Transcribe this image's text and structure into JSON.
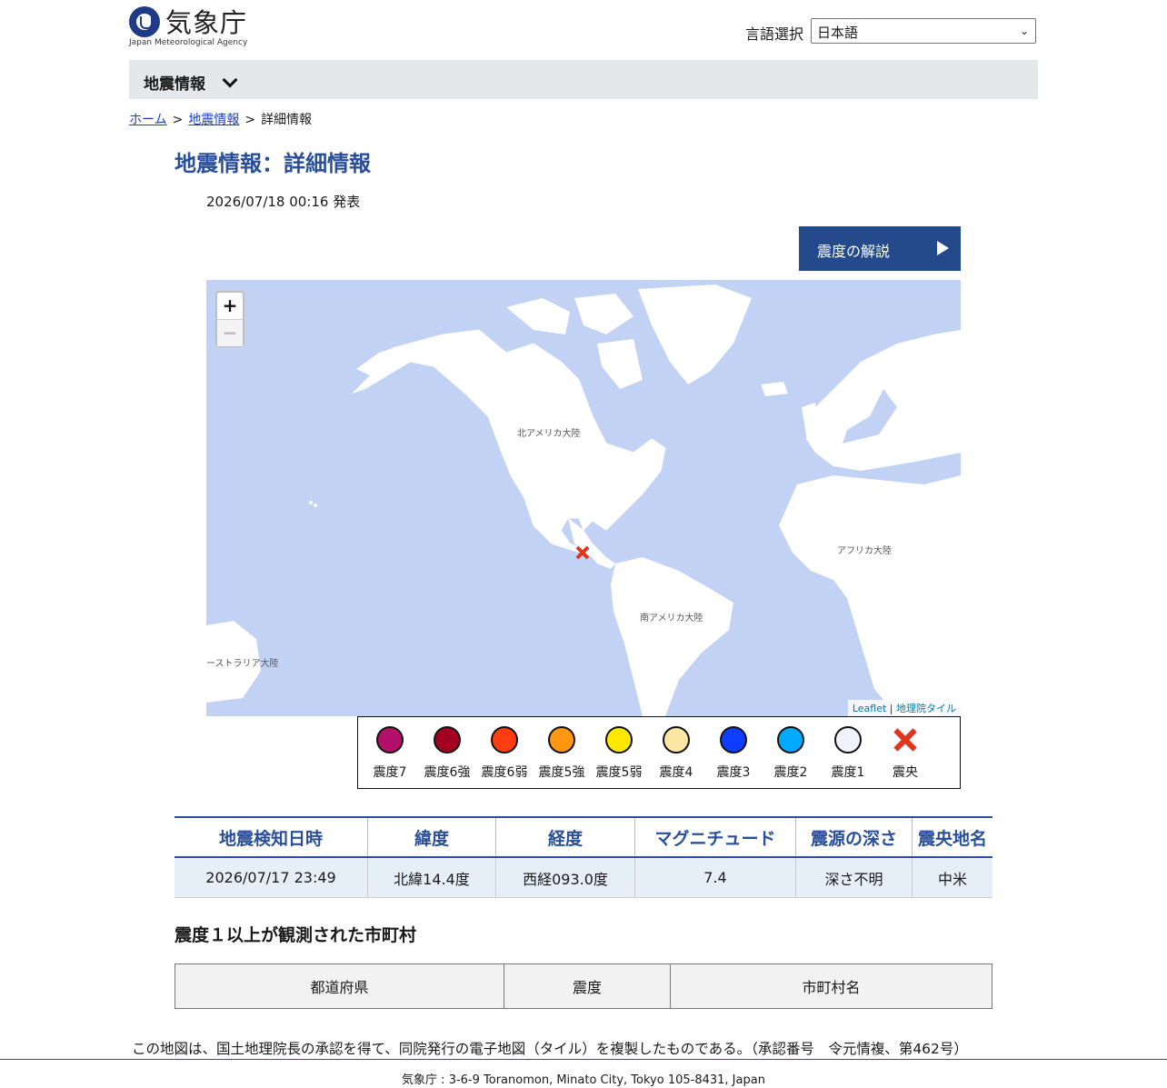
{
  "header": {
    "logo_text": "気象庁",
    "logo_subtitle": "Japan Meteorological Agency",
    "language_label": "言語選択",
    "language_value": "日本語"
  },
  "nav": {
    "title": "地震情報"
  },
  "breadcrumb": {
    "home": "ホーム",
    "section": "地震情報",
    "current": "詳細情報",
    "separator": ">"
  },
  "page": {
    "title": "地震情報：詳細情報",
    "published": "2026/07/18 00:16 発表",
    "explain_button": "震度の解説"
  },
  "map": {
    "zoom_in": "+",
    "zoom_out": "−",
    "labels": {
      "north_america": "北アメリカ大陸",
      "south_america": "南アメリカ大陸",
      "africa": "アフリカ大陸",
      "australia": "ーストラリア大陸"
    },
    "attribution_leaflet": "Leaflet",
    "attribution_sep": "|",
    "attribution_tiles": "地理院タイル",
    "colors": {
      "sea": "#c2d2f5",
      "land": "#ffffff",
      "epicenter": "#e0341c"
    }
  },
  "legend": [
    {
      "label": "震度7",
      "color": "#b2106a"
    },
    {
      "label": "震度6強",
      "color": "#a30022"
    },
    {
      "label": "震度6弱",
      "color": "#ff3d10"
    },
    {
      "label": "震度5強",
      "color": "#ff9712"
    },
    {
      "label": "震度5弱",
      "color": "#ffe800"
    },
    {
      "label": "震度4",
      "color": "#fbe6a3"
    },
    {
      "label": "震度3",
      "color": "#0f3dff"
    },
    {
      "label": "震度2",
      "color": "#00aaff"
    },
    {
      "label": "震度1",
      "color": "#f2f2ff"
    },
    {
      "label": "震央",
      "icon": "epicenter-x-icon"
    }
  ],
  "quake_table": {
    "headers": [
      "地震検知日時",
      "緯度",
      "経度",
      "マグニチュード",
      "震源の深さ",
      "震央地名"
    ],
    "row": [
      "2026/07/17 23:49",
      "北緯14.4度",
      "西経093.0度",
      "7.4",
      "深さ不明",
      "中米"
    ]
  },
  "observed": {
    "heading": "震度１以上が観測された市町村",
    "headers": [
      "都道府県",
      "震度",
      "市町村名"
    ]
  },
  "footnote": "この地図は、国土地理院長の承認を得て、同院発行の電子地図（タイル）を複製したものである。（承認番号　令元情複、第462号）",
  "footer": "気象庁 : 3-6-9 Toranomon, Minato City, Tokyo 105-8431, Japan"
}
